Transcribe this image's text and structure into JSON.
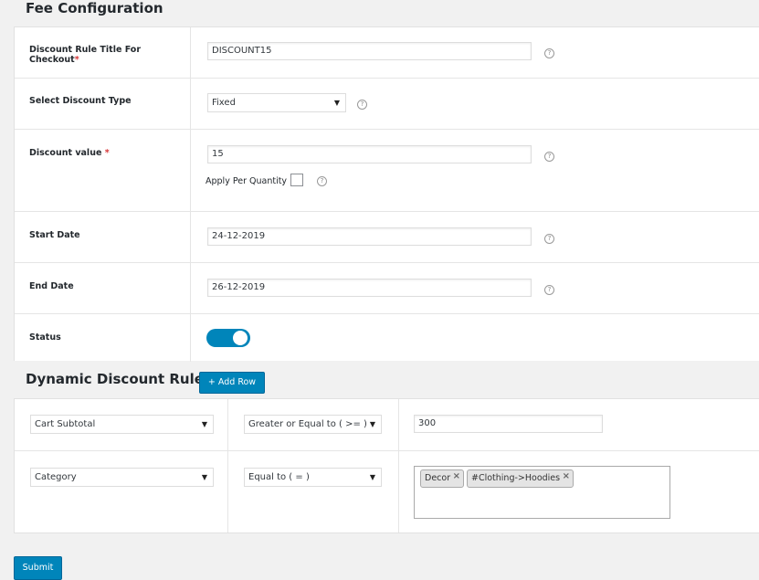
{
  "fee_config": {
    "heading": "Fee Configuration",
    "title_label": "Discount Rule Title For Checkout",
    "title_required": "*",
    "title_value": "DISCOUNT15",
    "type_label": "Select Discount Type",
    "type_value": "Fixed",
    "value_label": "Discount value",
    "value_required": "*",
    "value_value": "15",
    "apply_per_quantity_label": "Apply Per Quantity",
    "start_label": "Start Date",
    "start_value": "24-12-2019",
    "end_label": "End Date",
    "end_value": "26-12-2019",
    "status_label": "Status",
    "status_on": true,
    "help_glyph": "?"
  },
  "dynamic": {
    "heading": "Dynamic Discount Rule",
    "add_row_label": "+ Add Row",
    "rows": [
      {
        "field": "Cart Subtotal",
        "operator": "Greater or Equal to ( >= )",
        "value": "300"
      },
      {
        "field": "Category",
        "operator": "Equal to ( = )",
        "tags": [
          "Decor",
          "#Clothing->Hoodies"
        ]
      }
    ]
  },
  "submit_label": "Submit",
  "colors": {
    "primary": "#0085ba",
    "required": "#d63638"
  },
  "icons": {
    "dropdown": "caret-down-icon",
    "help": "question-circle-icon",
    "remove": "tag-remove-icon"
  }
}
